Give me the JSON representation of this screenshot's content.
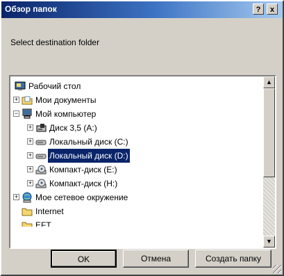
{
  "window": {
    "title": "Обзор папок",
    "help": "?",
    "close": "x"
  },
  "prompt": "Select destination folder",
  "tree": {
    "items": [
      {
        "label": "Рабочий стол",
        "icon": "desktop-icon",
        "expander": ""
      },
      {
        "label": "Мои документы",
        "icon": "folder-icon",
        "expander": "+"
      },
      {
        "label": "Мой компьютер",
        "icon": "computer-icon",
        "expander": "−"
      },
      {
        "label": "Диск 3,5 (A:)",
        "icon": "floppy-icon",
        "expander": "+"
      },
      {
        "label": "Локальный диск (C:)",
        "icon": "hard-drive-icon",
        "expander": "+"
      },
      {
        "label": "Локальный диск (D:)",
        "icon": "hard-drive-icon",
        "expander": "+",
        "selected": true
      },
      {
        "label": "Компакт-диск (E:)",
        "icon": "cd-drive-icon",
        "expander": "+"
      },
      {
        "label": "Компакт-диск (H:)",
        "icon": "cd-drive-icon",
        "expander": "+"
      },
      {
        "label": "Мое сетевое окружение",
        "icon": "network-icon",
        "expander": "+"
      },
      {
        "label": "Internet",
        "icon": "folder-icon",
        "expander": ""
      },
      {
        "label": "EFT",
        "icon": "folder-icon",
        "expander": ""
      }
    ]
  },
  "buttons": {
    "ok": "OK",
    "cancel": "Отмена",
    "new_folder": "Создать папку"
  },
  "colors": {
    "selection": "#0a246a",
    "titlebar_start": "#0a246a",
    "titlebar_end": "#a6caf0"
  }
}
